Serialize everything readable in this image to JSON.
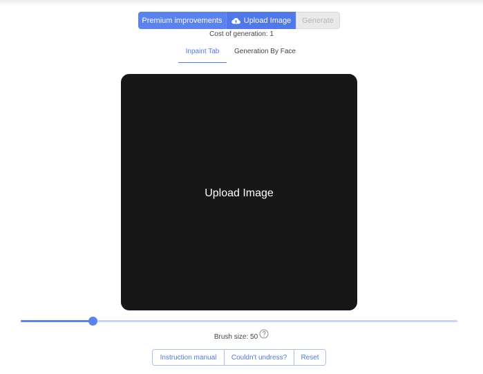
{
  "toolbar": {
    "premium_label": "Premium improvements",
    "upload_label": "Upload Image",
    "upload_icon": "cloud-upload-icon",
    "generate_label": "Generate",
    "generate_disabled": true
  },
  "cost_text": "Cost of generation: 1",
  "tabs": [
    {
      "label": "Inpaint Tab",
      "active": true
    },
    {
      "label": "Generation By Face",
      "active": false
    }
  ],
  "canvas": {
    "label": "Upload Image"
  },
  "brush": {
    "label": "Brush size: 50",
    "value": 50,
    "fraction": 0.165,
    "help_icon": "question-circle-icon"
  },
  "footer": {
    "manual_label": "Instruction manual",
    "undress_label": "Couldn't undress?",
    "reset_label": "Reset"
  },
  "colors": {
    "accent": "#5b82f1",
    "canvas_bg": "#171717",
    "track": "#c5d3fb",
    "disabled": "#e9e9e9"
  }
}
